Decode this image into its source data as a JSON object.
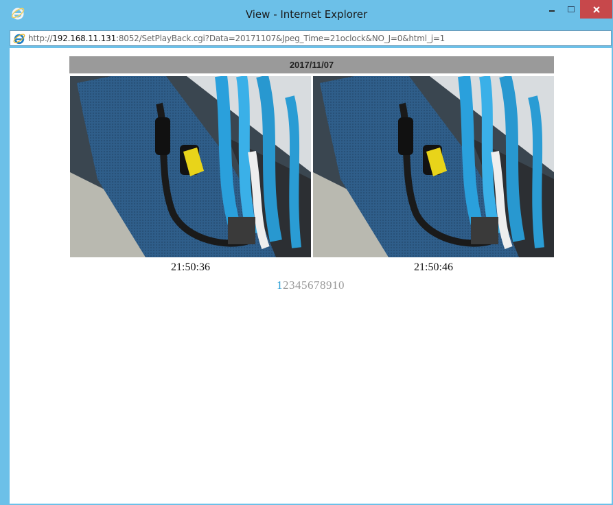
{
  "window": {
    "title": "View - Internet Explorer",
    "icon": "internet-explorer-icon",
    "controls": {
      "minimize": "minimize-icon",
      "maximize": "maximize-icon",
      "close": "close-icon"
    },
    "close_color": "#c7484b",
    "frame_color": "#6cc0e8"
  },
  "address": {
    "scheme": "http://",
    "host": "192.168.11.131",
    "rest": ":8052/SetPlayBack.cgi?Data=20171107&Jpeg_Time=21oclock&NO_J=0&html_j=1"
  },
  "playback": {
    "date": "2017/11/07",
    "snapshots": [
      {
        "time": "21:50:36"
      },
      {
        "time": "21:50:46"
      }
    ],
    "pages": [
      "1",
      "2",
      "3",
      "4",
      "5",
      "6",
      "7",
      "8",
      "9",
      "10"
    ],
    "active_page": "1",
    "active_color": "#2a9fd6",
    "inactive_color": "#9a9a9a",
    "date_bar_color": "#9a9a9a"
  }
}
